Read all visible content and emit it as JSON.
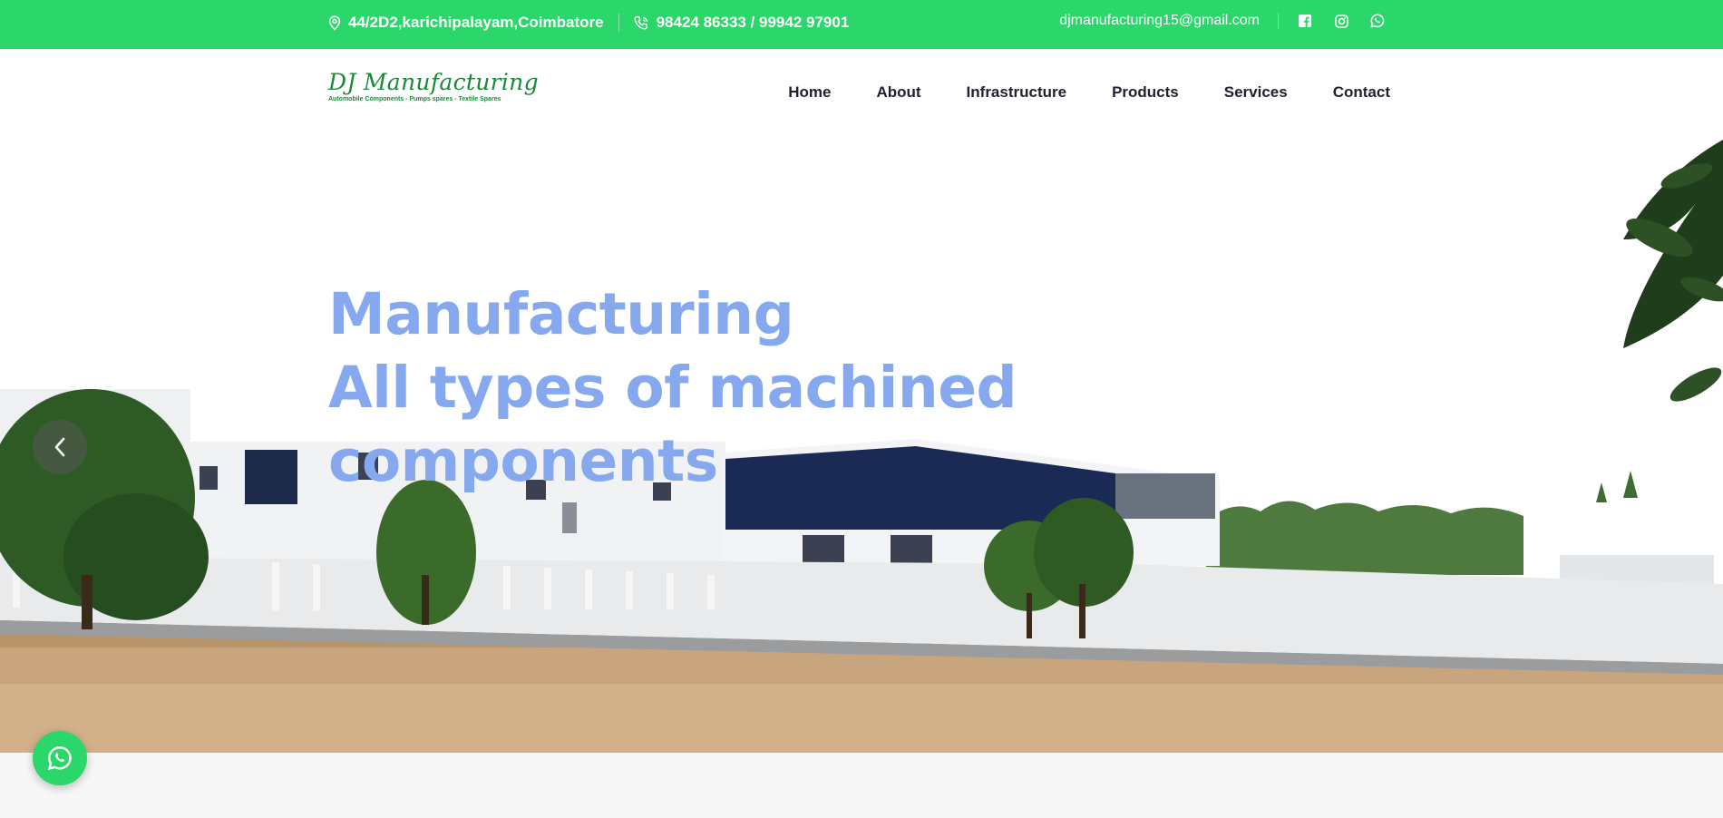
{
  "topbar": {
    "address": "44/2D2,karichipalayam,Coimbatore",
    "phone": "98424 86333 / 99942 97901",
    "email": "djmanufacturing15@gmail.com",
    "social": [
      {
        "icon": "facebook-icon"
      },
      {
        "icon": "instagram-icon"
      },
      {
        "icon": "whatsapp-icon"
      }
    ]
  },
  "logo": {
    "title": "DJ Manufacturing",
    "tagline": "Automobile Components - Pumps spares - Textile Spares"
  },
  "nav": {
    "items": [
      "Home",
      "About",
      "Infrastructure",
      "Products",
      "Services",
      "Contact"
    ]
  },
  "hero": {
    "lines": [
      "Manufacturing",
      "All types of machined",
      "components"
    ]
  },
  "colors": {
    "accent": "#2bd66a",
    "hero_text": "#86a8ee",
    "logo_green": "#1a8a3a"
  }
}
